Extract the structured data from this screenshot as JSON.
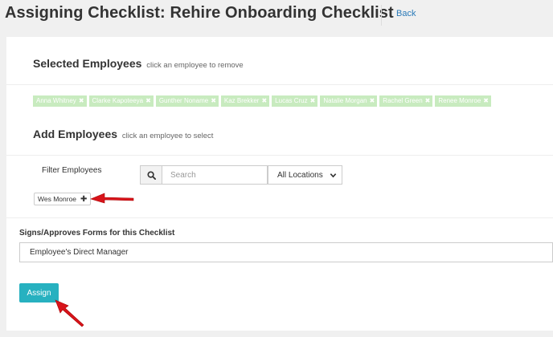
{
  "header": {
    "title": "Assigning Checklist: Rehire Onboarding Checklist",
    "back_label": "Back"
  },
  "selected": {
    "title": "Selected Employees",
    "hint": "click an employee to remove",
    "employees": [
      {
        "name": "Anna Whitney"
      },
      {
        "name": "Clarke Kapoteeya"
      },
      {
        "name": "Gunther Noname"
      },
      {
        "name": "Kaz Brekker"
      },
      {
        "name": "Lucas Cruz"
      },
      {
        "name": "Natalie Morgan"
      },
      {
        "name": "Rachel Green"
      },
      {
        "name": "Renee Monroe"
      }
    ],
    "remove_glyph": "✖",
    "chip_color": "#c8ebbf"
  },
  "add": {
    "title": "Add Employees",
    "hint": "click an employee to select",
    "filter_label": "Filter Employees",
    "search_placeholder": "Search",
    "location_value": "All Locations",
    "available": [
      {
        "name": "Wes Monroe"
      }
    ],
    "add_glyph": "✚"
  },
  "forms": {
    "label": "Signs/Approves Forms for this Checklist",
    "selected_value": "Employee's Direct Manager"
  },
  "actions": {
    "assign_label": "Assign",
    "assign_color": "#27b1c0"
  },
  "icons": {
    "search": "search-icon",
    "caret": "chevron-down-icon",
    "annotation": "red-arrow-icon"
  },
  "colors": {
    "link": "#2a7ab8",
    "annotation_arrow": "#d8141b"
  }
}
